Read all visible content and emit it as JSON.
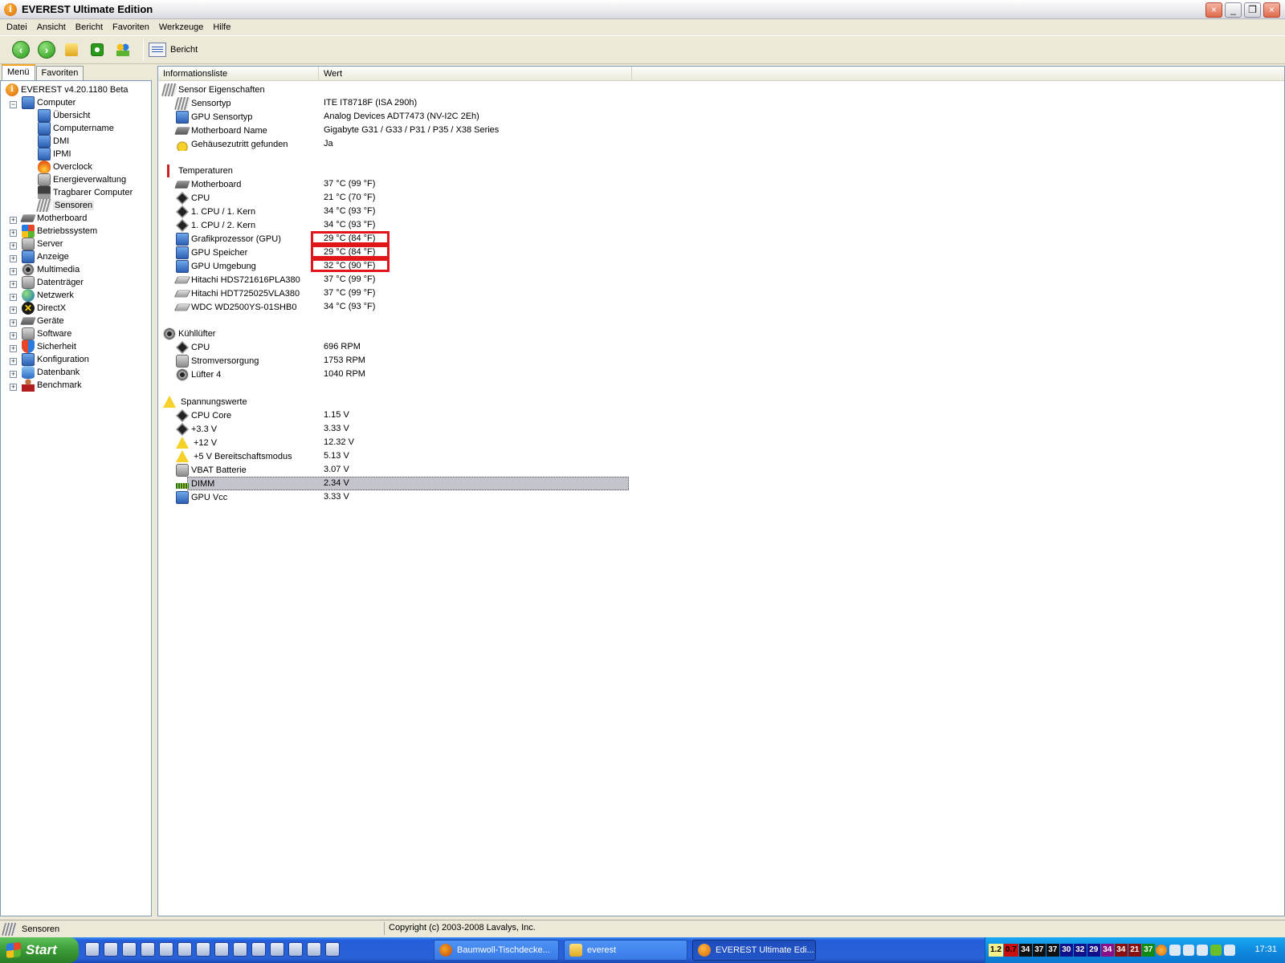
{
  "window": {
    "title": "EVEREST Ultimate Edition"
  },
  "menu": [
    "Datei",
    "Ansicht",
    "Bericht",
    "Favoriten",
    "Werkzeuge",
    "Hilfe"
  ],
  "toolbar": {
    "report_label": "Bericht"
  },
  "tabs": {
    "menu": "Menü",
    "favorites": "Favoriten"
  },
  "tree": {
    "root": "EVEREST v4.20.1180 Beta",
    "computer": "Computer",
    "computer_children": [
      "Übersicht",
      "Computername",
      "DMI",
      "IPMI",
      "Overclock",
      "Energieverwaltung",
      "Tragbarer Computer",
      "Sensoren"
    ],
    "groups": [
      "Motherboard",
      "Betriebssystem",
      "Server",
      "Anzeige",
      "Multimedia",
      "Datenträger",
      "Netzwerk",
      "DirectX",
      "Geräte",
      "Software",
      "Sicherheit",
      "Konfiguration",
      "Datenbank",
      "Benchmark"
    ]
  },
  "columns": {
    "info": "Informationsliste",
    "value": "Wert"
  },
  "sections": {
    "sensor": {
      "title": "Sensor Eigenschaften",
      "rows": [
        {
          "label": "Sensortyp",
          "value": "ITE IT8718F  (ISA 290h)"
        },
        {
          "label": "GPU Sensortyp",
          "value": "Analog Devices ADT7473  (NV-I2C 2Eh)"
        },
        {
          "label": "Motherboard Name",
          "value": "Gigabyte G31 / G33 / P31 / P35 / X38 Series"
        },
        {
          "label": "Gehäusezutritt gefunden",
          "value": "Ja"
        }
      ]
    },
    "temps": {
      "title": "Temperaturen",
      "rows": [
        {
          "label": "Motherboard",
          "value": "37 °C  (99 °F)"
        },
        {
          "label": "CPU",
          "value": "21 °C  (70 °F)"
        },
        {
          "label": "1. CPU / 1. Kern",
          "value": "34 °C  (93 °F)"
        },
        {
          "label": "1. CPU / 2. Kern",
          "value": "34 °C  (93 °F)"
        },
        {
          "label": "Grafikprozessor (GPU)",
          "value": "29 °C  (84 °F)"
        },
        {
          "label": "GPU Speicher",
          "value": "29 °C  (84 °F)"
        },
        {
          "label": "GPU Umgebung",
          "value": "32 °C  (90 °F)"
        },
        {
          "label": "Hitachi HDS721616PLA380",
          "value": "37 °C  (99 °F)"
        },
        {
          "label": "Hitachi HDT725025VLA380",
          "value": "37 °C  (99 °F)"
        },
        {
          "label": "WDC WD2500YS-01SHB0",
          "value": "34 °C  (93 °F)"
        }
      ]
    },
    "fans": {
      "title": "Kühllüfter",
      "rows": [
        {
          "label": "CPU",
          "value": "696 RPM"
        },
        {
          "label": "Stromversorgung",
          "value": "1753 RPM"
        },
        {
          "label": "Lüfter 4",
          "value": "1040 RPM"
        }
      ]
    },
    "volts": {
      "title": "Spannungswerte",
      "rows": [
        {
          "label": "CPU Core",
          "value": "1.15 V"
        },
        {
          "label": "+3.3 V",
          "value": "3.33 V"
        },
        {
          "label": "+12 V",
          "value": "12.32 V"
        },
        {
          "label": "+5 V Bereitschaftsmodus",
          "value": "5.13 V"
        },
        {
          "label": "VBAT Batterie",
          "value": "3.07 V"
        },
        {
          "label": "DIMM",
          "value": "2.34 V"
        },
        {
          "label": "GPU Vcc",
          "value": "3.33 V"
        }
      ]
    }
  },
  "status": {
    "left": "Sensoren",
    "right": "Copyright (c) 2003-2008 Lavalys, Inc."
  },
  "taskbar": {
    "start": "Start",
    "tasks": [
      "Baumwoll-Tischdecke...",
      "everest",
      "EVEREST Ultimate Edi..."
    ],
    "tray_numbers": [
      {
        "text": "1.2",
        "bg": "#f5f08a",
        "fg": "#000000"
      },
      {
        "text": "0.7",
        "bg": "#c81010",
        "fg": "#000000"
      },
      {
        "text": "34",
        "bg": "#101010",
        "fg": "#ffffff"
      },
      {
        "text": "37",
        "bg": "#101010",
        "fg": "#ffffff"
      },
      {
        "text": "37",
        "bg": "#101010",
        "fg": "#ffffff"
      },
      {
        "text": "30",
        "bg": "#10108a",
        "fg": "#ffffff"
      },
      {
        "text": "32",
        "bg": "#10108a",
        "fg": "#ffffff"
      },
      {
        "text": "29",
        "bg": "#10108a",
        "fg": "#ffffff"
      },
      {
        "text": "34",
        "bg": "#8a108a",
        "fg": "#ffffff"
      },
      {
        "text": "34",
        "bg": "#8a1010",
        "fg": "#ffffff"
      },
      {
        "text": "21",
        "bg": "#8a1010",
        "fg": "#ffffff"
      },
      {
        "text": "37",
        "bg": "#108a10",
        "fg": "#ffffff"
      }
    ],
    "clock": "17:31"
  }
}
